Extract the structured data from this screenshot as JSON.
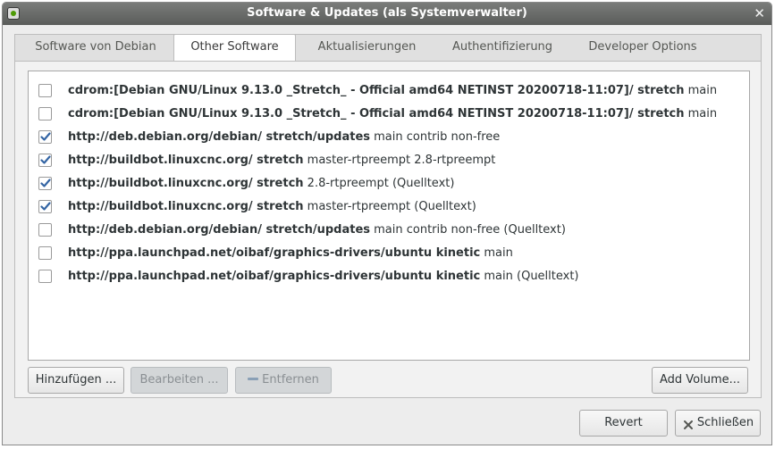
{
  "window": {
    "title": "Software & Updates (als Systemverwalter)",
    "close_glyph": "✕"
  },
  "tabs": [
    {
      "label": "Software von Debian"
    },
    {
      "label": "Other Software"
    },
    {
      "label": "Aktualisierungen"
    },
    {
      "label": "Authentifizierung"
    },
    {
      "label": "Developer Options"
    }
  ],
  "active_tab": "Other Software",
  "sources": [
    {
      "checked": false,
      "bold": "cdrom:[Debian GNU/Linux 9.13.0 _Stretch_ - Official amd64 NETINST 20200718-11:07]/ stretch",
      "rest": " main"
    },
    {
      "checked": false,
      "bold": "cdrom:[Debian GNU/Linux 9.13.0 _Stretch_ - Official amd64 NETINST 20200718-11:07]/ stretch",
      "rest": " main"
    },
    {
      "checked": true,
      "bold": "http://deb.debian.org/debian/ stretch/updates",
      "rest": " main contrib non-free"
    },
    {
      "checked": true,
      "bold": "http://buildbot.linuxcnc.org/ stretch",
      "rest": " master-rtpreempt 2.8-rtpreempt"
    },
    {
      "checked": true,
      "bold": "http://buildbot.linuxcnc.org/ stretch",
      "rest": " 2.8-rtpreempt (Quelltext)"
    },
    {
      "checked": true,
      "bold": "http://buildbot.linuxcnc.org/ stretch",
      "rest": " master-rtpreempt (Quelltext)"
    },
    {
      "checked": false,
      "bold": "http://deb.debian.org/debian/ stretch/updates",
      "rest": " main contrib non-free (Quelltext)"
    },
    {
      "checked": false,
      "bold": "http://ppa.launchpad.net/oibaf/graphics-drivers/ubuntu kinetic",
      "rest": " main"
    },
    {
      "checked": false,
      "bold": "http://ppa.launchpad.net/oibaf/graphics-drivers/ubuntu kinetic",
      "rest": " main (Quelltext)"
    }
  ],
  "buttons": {
    "add": "Hinzufügen ...",
    "edit": "Bearbeiten ...",
    "remove": "Entfernen",
    "add_volume": "Add Volume...",
    "revert": "Revert",
    "close": "Schließen"
  },
  "colors": {
    "check_accent": "#3465a4",
    "titlebar": "#6a6c6a"
  }
}
